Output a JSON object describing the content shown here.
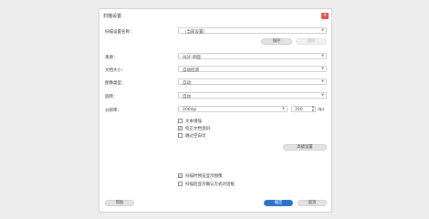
{
  "dialog": {
    "title": "扫描设置",
    "close_glyph": "×",
    "preset_label": "扫描设置名称：",
    "preset_value": "（当前设置）",
    "save_label": "保存",
    "delete_label": "删除",
    "source_label": "来源：",
    "source_value": "ADF-单面",
    "docsize_label": "文档大小：",
    "docsize_value": "自动检测",
    "imagetype_label": "图像类型：",
    "imagetype_value": "自动",
    "rotate_label": "旋转：",
    "rotate_value": "自动",
    "resolution_label": "分辨率：",
    "resolution_value": "200dpi",
    "resolution_number": "200",
    "resolution_unit": "dpi",
    "options": [
      {
        "label": "文本增强",
        "checked": false
      },
      {
        "label": "校正文档歪斜",
        "checked": true
      },
      {
        "label": "跳过空白页",
        "checked": false
      }
    ],
    "advanced_label": "高级设置",
    "bottom_options": [
      {
        "label": "扫描时预览显示图像",
        "checked": true
      },
      {
        "label": "扫描后显示确认方式对话框",
        "checked": false
      }
    ],
    "help_label": "帮助",
    "ok_label": "确定",
    "cancel_label": "取消"
  },
  "colors": {
    "accent": "#2b73c8",
    "close": "#d9534f",
    "background": "#ededed"
  },
  "icons": {
    "dropdown": "chevron-down-icon",
    "spinner": "spinner-arrows-icon",
    "close": "close-icon"
  }
}
